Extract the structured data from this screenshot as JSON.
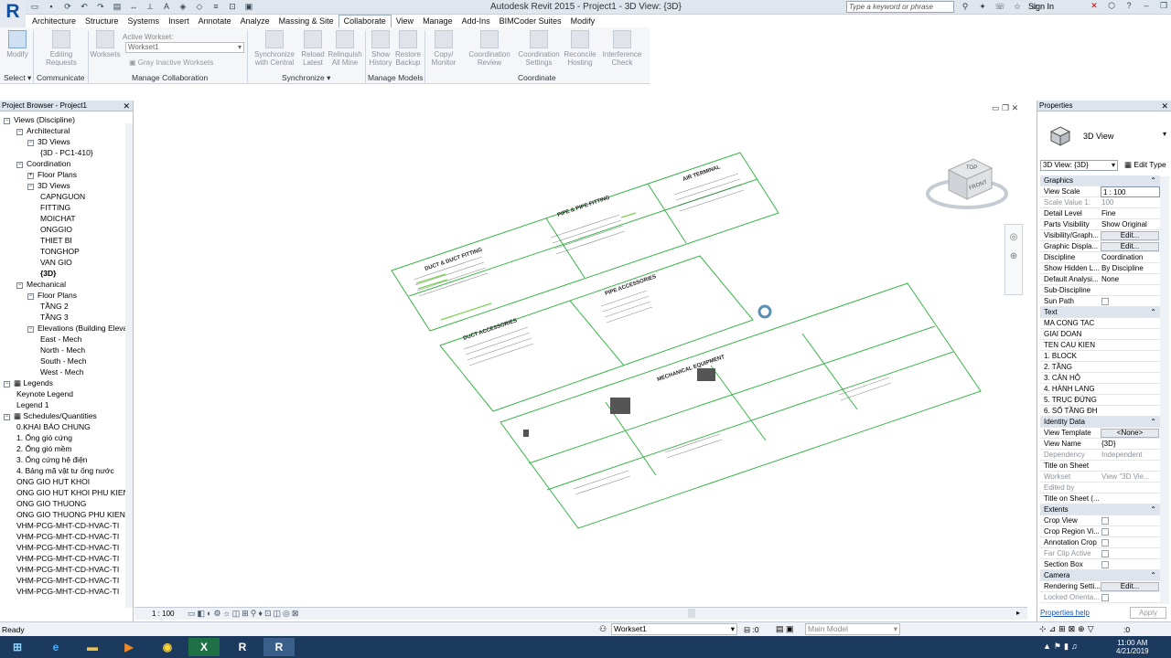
{
  "window": {
    "title": "Autodesk Revit 2015 -    Project1 - 3D View: {3D}"
  },
  "search": {
    "placeholder": "Type a keyword or phrase"
  },
  "user": {
    "signin": "Sign In"
  },
  "menu_tabs": [
    "Architecture",
    "Structure",
    "Systems",
    "Insert",
    "Annotate",
    "Analyze",
    "Massing & Site",
    "Collaborate",
    "View",
    "Manage",
    "Add-Ins",
    "BIMCoder Suites",
    "Modify"
  ],
  "ribbon": {
    "modify": "Modify",
    "editing_requests": "Editing Requests",
    "worksets": "Worksets",
    "active_workset_label": "Active Workset:",
    "active_workset_value": "Workset1",
    "gray_inactive": "Gray Inactive Worksets",
    "sync_central": "Synchronize with Central",
    "reload_latest": "Reload Latest",
    "relinquish_all": "Relinquish All Mine",
    "show_history": "Show History",
    "restore_backup": "Restore Backup",
    "copy_monitor": "Copy/ Monitor",
    "coord_review": "Coordination Review",
    "coord_settings": "Coordination Settings",
    "reconcile_hosting": "Reconcile Hosting",
    "interference_check": "Interference Check",
    "panels": {
      "select": "Select",
      "communicate": "Communicate",
      "manage_collab": "Manage Collaboration",
      "synchronize": "Synchronize",
      "manage_models": "Manage Models",
      "coordinate": "Coordinate"
    }
  },
  "project_browser": {
    "title": "Project Browser - Project1",
    "items": [
      {
        "label": "Views (Discipline)",
        "toggle": "−"
      },
      {
        "label": "Architectural",
        "toggle": "−"
      },
      {
        "label": "3D Views",
        "toggle": "−"
      },
      {
        "label": "{3D - PC1-410}",
        "toggle": ""
      },
      {
        "label": "Coordination",
        "toggle": "−"
      },
      {
        "label": "Floor Plans",
        "toggle": "+"
      },
      {
        "label": "3D Views",
        "toggle": "−"
      },
      {
        "label": "CAPNGUON",
        "toggle": ""
      },
      {
        "label": "FITTING",
        "toggle": ""
      },
      {
        "label": "MOICHAT",
        "toggle": ""
      },
      {
        "label": "ONGGIO",
        "toggle": ""
      },
      {
        "label": "THIET BI",
        "toggle": ""
      },
      {
        "label": "TONGHOP",
        "toggle": ""
      },
      {
        "label": "VAN GIO",
        "toggle": ""
      },
      {
        "label": "{3D}",
        "toggle": ""
      },
      {
        "label": "Mechanical",
        "toggle": "−"
      },
      {
        "label": "Floor Plans",
        "toggle": "−"
      },
      {
        "label": "TẦNG 2",
        "toggle": ""
      },
      {
        "label": "TẦNG 3",
        "toggle": ""
      },
      {
        "label": "Elevations (Building Eleva",
        "toggle": "−"
      },
      {
        "label": "East - Mech",
        "toggle": ""
      },
      {
        "label": "North - Mech",
        "toggle": ""
      },
      {
        "label": "South - Mech",
        "toggle": ""
      },
      {
        "label": "West - Mech",
        "toggle": ""
      },
      {
        "label": "Legends",
        "toggle": "−"
      },
      {
        "label": "Keynote Legend",
        "toggle": ""
      },
      {
        "label": "Legend 1",
        "toggle": ""
      },
      {
        "label": "Schedules/Quantities",
        "toggle": "−"
      },
      {
        "label": "0.KHAI BÁO CHUNG",
        "toggle": ""
      },
      {
        "label": "1. Ống gió cứng",
        "toggle": ""
      },
      {
        "label": "2. Ống gió mềm",
        "toggle": ""
      },
      {
        "label": "3. Ống cứng hệ điện",
        "toggle": ""
      },
      {
        "label": "4. Bảng mã vật tư ống nước",
        "toggle": ""
      },
      {
        "label": "ONG GIO HUT KHOI",
        "toggle": ""
      },
      {
        "label": "ONG GIO HUT KHOI PHU KIEN",
        "toggle": ""
      },
      {
        "label": "ONG GIO THUONG",
        "toggle": ""
      },
      {
        "label": "ONG GIO THUONG PHU KIEN",
        "toggle": ""
      },
      {
        "label": "VHM-PCG-MHT-CD-HVAC-TI",
        "toggle": ""
      },
      {
        "label": "VHM-PCG-MHT-CD-HVAC-TI",
        "toggle": ""
      },
      {
        "label": "VHM-PCG-MHT-CD-HVAC-TI",
        "toggle": ""
      },
      {
        "label": "VHM-PCG-MHT-CD-HVAC-TI",
        "toggle": ""
      },
      {
        "label": "VHM-PCG-MHT-CD-HVAC-TI",
        "toggle": ""
      },
      {
        "label": "VHM-PCG-MHT-CD-HVAC-TI",
        "toggle": ""
      },
      {
        "label": "VHM-PCG-MHT-CD-HVAC-TI",
        "toggle": ""
      }
    ]
  },
  "viewport": {
    "scale": "1 : 100",
    "viewcube_top": "TOP",
    "viewcube_front": "FRONT",
    "sheets": {
      "duct_fitting": "DUCT & DUCT FITTING",
      "pipe_fitting": "PIPE & PIPE FITTING",
      "air_terminal": "AIR TERMINAL",
      "duct_accessories": "DUCT ACCESSORIES",
      "pipe_accessories": "PIPE ACCESSORIES",
      "mechanical_equipment": "MECHANICAL EQUIPMENT"
    }
  },
  "properties": {
    "title": "Properties",
    "type_name": "3D View",
    "selector": "3D View: {3D}",
    "edit_type": "Edit Type",
    "rows": [
      {
        "k": "Graphics",
        "group": true
      },
      {
        "k": "View Scale",
        "v": "1 : 100",
        "kind": "input"
      },
      {
        "k": "Scale Value    1:",
        "v": "100",
        "dim": true
      },
      {
        "k": "Detail Level",
        "v": "Fine"
      },
      {
        "k": "Parts Visibility",
        "v": "Show Original"
      },
      {
        "k": "Visibility/Graph...",
        "v": "Edit...",
        "kind": "button"
      },
      {
        "k": "Graphic Displa...",
        "v": "Edit...",
        "kind": "button"
      },
      {
        "k": "Discipline",
        "v": "Coordination"
      },
      {
        "k": "Show Hidden L...",
        "v": "By Discipline"
      },
      {
        "k": "Default Analysi...",
        "v": "None"
      },
      {
        "k": "Sub-Discipline",
        "v": ""
      },
      {
        "k": "Sun Path",
        "v": "",
        "kind": "check"
      },
      {
        "k": "Text",
        "group": true
      },
      {
        "k": "MA CONG TAC",
        "v": ""
      },
      {
        "k": "GIAI DOAN",
        "v": ""
      },
      {
        "k": "TEN CAU KIEN",
        "v": ""
      },
      {
        "k": "1. BLOCK",
        "v": ""
      },
      {
        "k": "2. TẦNG",
        "v": ""
      },
      {
        "k": "3. CĂN HỘ",
        "v": ""
      },
      {
        "k": "4. HÀNH LANG",
        "v": ""
      },
      {
        "k": "5. TRỤC ĐỨNG",
        "v": ""
      },
      {
        "k": "6. SỐ TẦNG ĐH",
        "v": ""
      },
      {
        "k": "Identity Data",
        "group": true
      },
      {
        "k": "View Template",
        "v": "<None>",
        "kind": "button"
      },
      {
        "k": "View Name",
        "v": "{3D}"
      },
      {
        "k": "Dependency",
        "v": "Independent",
        "dim": true
      },
      {
        "k": "Title on Sheet",
        "v": ""
      },
      {
        "k": "Workset",
        "v": "View \"3D Vie...",
        "dim": true
      },
      {
        "k": "Edited by",
        "v": "",
        "dim": true
      },
      {
        "k": "Title on Sheet (...",
        "v": ""
      },
      {
        "k": "Extents",
        "group": true
      },
      {
        "k": "Crop View",
        "v": "",
        "kind": "check"
      },
      {
        "k": "Crop Region Vi...",
        "v": "",
        "kind": "check"
      },
      {
        "k": "Annotation Crop",
        "v": "",
        "kind": "check"
      },
      {
        "k": "Far Clip Active",
        "v": "",
        "kind": "check",
        "dim": true
      },
      {
        "k": "Section Box",
        "v": "",
        "kind": "check"
      },
      {
        "k": "Camera",
        "group": true
      },
      {
        "k": "Rendering Setti...",
        "v": "Edit...",
        "kind": "button"
      },
      {
        "k": "Locked Orienta...",
        "v": "",
        "kind": "check",
        "dim": true
      }
    ],
    "help": "Properties help",
    "apply": "Apply"
  },
  "status": {
    "ready": "Ready",
    "workset": "Workset1",
    "count": ":0",
    "main_model": "Main Model",
    "filter_count": ":0"
  },
  "clock": {
    "time": "11:00 AM",
    "date": "4/21/2019"
  },
  "taskbar_apps": [
    "start-icon",
    "internet-explorer-icon",
    "file-explorer-icon",
    "media-player-icon",
    "chrome-icon",
    "excel-icon",
    "revit-icon",
    "revit-icon"
  ]
}
